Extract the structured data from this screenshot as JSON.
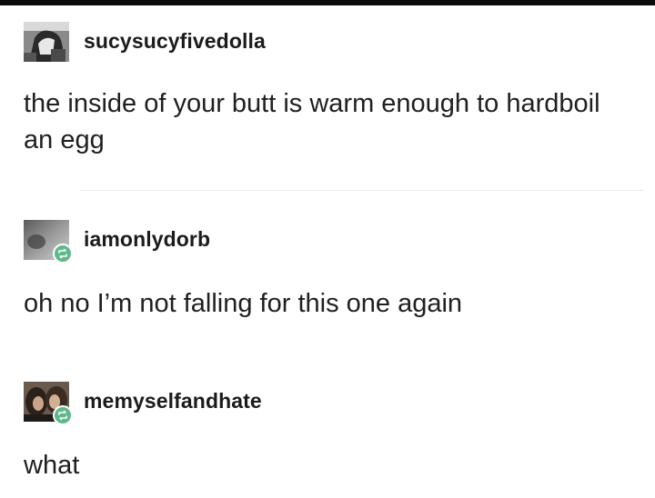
{
  "thread": {
    "posts": [
      {
        "username": "sucysucyfivedolla",
        "text": "the inside of your butt is warm enough to hardboil an egg",
        "avatar_icon": "avatar-photo",
        "reblog": false
      },
      {
        "username": "iamonlydorb",
        "text": "oh no I’m not falling for this one again",
        "avatar_icon": "avatar-photo",
        "reblog": true,
        "reblog_color": "#5fb88a"
      },
      {
        "username": "memyselfandhate",
        "text": "what",
        "avatar_icon": "avatar-photo",
        "reblog": true,
        "reblog_color": "#5fb88a"
      }
    ]
  }
}
